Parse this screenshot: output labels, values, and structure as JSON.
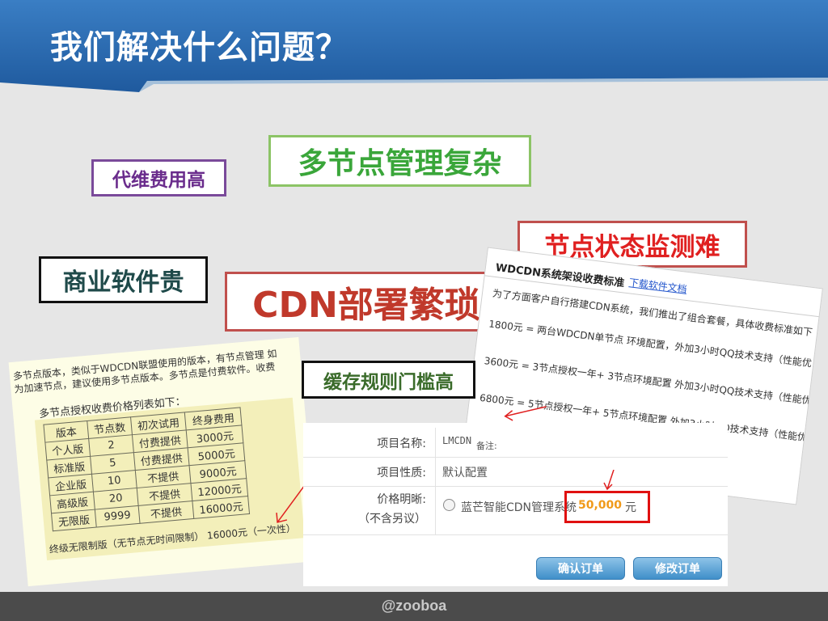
{
  "slide": {
    "title": "我们解决什么问题？",
    "footer": "@zooboa"
  },
  "keywords": [
    {
      "text": "代维费用高",
      "color": "#6a2c8c"
    },
    {
      "text": "多节点管理复杂",
      "color": "#3aa63a"
    },
    {
      "text": "节点状态监测难",
      "color": "#e02020"
    },
    {
      "text": "商业软件贵",
      "color": "#1f4a4a"
    },
    {
      "text": "CDN部署繁琐",
      "color": "#c0392b"
    },
    {
      "text": "缓存规则门槛高",
      "color": "#3a6b2a"
    }
  ],
  "screenshot_left": {
    "intro_line1": "多节点版本，类似于WDCDN联盟使用的版本，有节点管理 如",
    "intro_line2": "为加速节点，建议使用多节点版本。多节点是付费软件。收费",
    "table_caption": "多节点授权收费价格列表如下：",
    "headers": [
      "版本",
      "节点数",
      "初次试用",
      "终身费用"
    ],
    "rows": [
      [
        "个人版",
        "2",
        "付费提供",
        "3000元"
      ],
      [
        "标准版",
        "5",
        "付费提供",
        "5000元"
      ],
      [
        "企业版",
        "10",
        "不提供",
        "9000元"
      ],
      [
        "高级版",
        "20",
        "不提供",
        "12000元"
      ],
      [
        "无限版",
        "9999",
        "不提供",
        "16000元"
      ]
    ],
    "footer_note": "终级无限制版（无节点无时间限制） 16000元（一次性）"
  },
  "screenshot_right": {
    "title": "WDCDN系统架设收费标准",
    "link": "下载软件文档",
    "line1": "为了方面客户自行搭建CDN系统，我们推出了组合套餐，具体收费标准如下",
    "line2": "1800元 = 两台WDCDN单节点 环境配置，外加3小时QQ技术支持（性能优",
    "line3": "3600元 = 3节点授权一年+ 3节点环境配置 外加3小时QQ技术支持（性能优",
    "line4": "6800元 = 5节点授权一年+ 5节点环境配置 外加3小时QQ技术支持（性能优"
  },
  "order_form": {
    "name_label": "项目名称:",
    "name_value": "LMCDN",
    "name_note": "备注:",
    "type_label": "项目性质:",
    "type_value": "默认配置",
    "price_label": "价格明晰:",
    "price_sub": "（不含另议）",
    "product": "蓝芒智能CDN管理系统",
    "price": "50,000",
    "currency": "元",
    "confirm_button": "确认订单",
    "modify_button": "修改订单"
  }
}
